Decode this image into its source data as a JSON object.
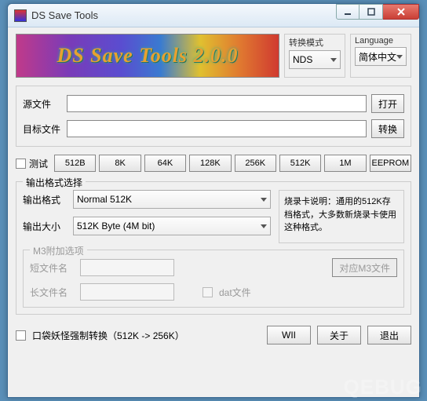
{
  "window": {
    "title": "DS Save Tools"
  },
  "banner": {
    "text": "DS Save Tools 2.0.0"
  },
  "top": {
    "mode_label": "转换模式",
    "mode_value": "NDS",
    "lang_label": "Language",
    "lang_value": "简体中文"
  },
  "files": {
    "source_label": "源文件",
    "source_value": "",
    "open_btn": "打开",
    "target_label": "目标文件",
    "target_value": "",
    "convert_btn": "转换"
  },
  "sizes": {
    "test_label": "测试",
    "buttons": [
      "512B",
      "8K",
      "64K",
      "128K",
      "256K",
      "512K",
      "1M",
      "EEPROM"
    ]
  },
  "output": {
    "group_title": "输出格式选择",
    "format_label": "输出格式",
    "format_value": "Normal 512K",
    "size_label": "输出大小",
    "size_value": "512K Byte (4M bit)",
    "desc": "烧录卡说明：通用的512K存档格式，大多数新烧录卡使用这种格式。"
  },
  "m3": {
    "group_title": "M3附加选项",
    "short_label": "短文件名",
    "short_value": "",
    "match_btn": "对应M3文件",
    "long_label": "长文件名",
    "long_value": "",
    "dat_label": "dat文件"
  },
  "bottom": {
    "pokemon_label": "口袋妖怪强制转换（512K -> 256K）",
    "wii_btn": "WII",
    "about_btn": "关于",
    "exit_btn": "退出"
  },
  "watermark": "QEBUG"
}
